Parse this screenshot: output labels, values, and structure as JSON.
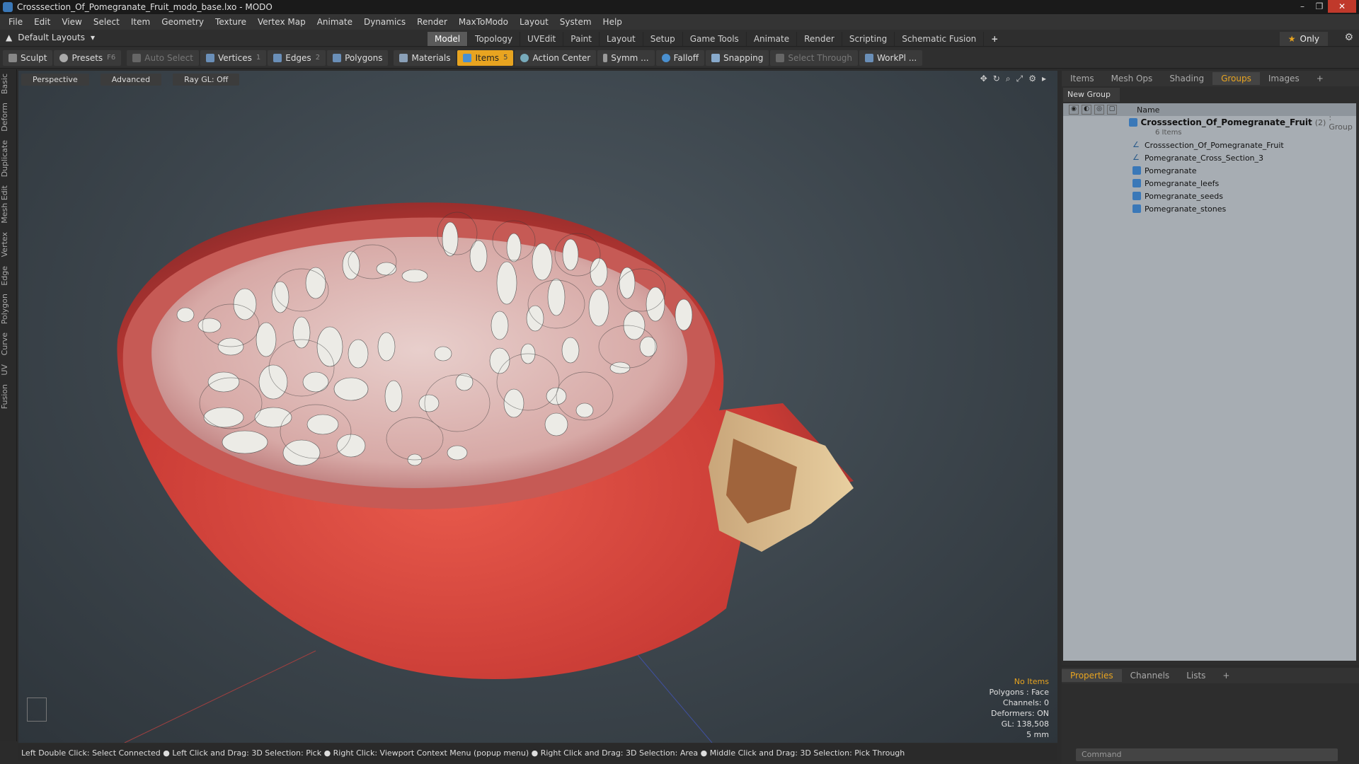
{
  "window": {
    "title": "Crosssection_Of_Pomegranate_Fruit_modo_base.lxo - MODO"
  },
  "menu": [
    "File",
    "Edit",
    "View",
    "Select",
    "Item",
    "Geometry",
    "Texture",
    "Vertex Map",
    "Animate",
    "Dynamics",
    "Render",
    "MaxToModo",
    "Layout",
    "System",
    "Help"
  ],
  "layout": {
    "default_layouts": "Default Layouts",
    "tabs": [
      "Model",
      "Topology",
      "UVEdit",
      "Paint",
      "Layout",
      "Setup",
      "Game Tools",
      "Animate",
      "Render",
      "Scripting",
      "Schematic Fusion"
    ],
    "active_tab": "Model",
    "only_label": "Only"
  },
  "toolbar": {
    "sculpt": "Sculpt",
    "presets": "Presets",
    "presets_key": "F6",
    "auto_select": "Auto Select",
    "vertices": "Vertices",
    "vertices_key": "1",
    "edges": "Edges",
    "edges_key": "2",
    "polygons": "Polygons",
    "materials": "Materials",
    "items": "Items",
    "items_key": "5",
    "action_center": "Action Center",
    "symm": "Symm ...",
    "falloff": "Falloff",
    "snapping": "Snapping",
    "select_through": "Select Through",
    "workpl": "WorkPl ..."
  },
  "left_tabs": [
    "Basic",
    "Deform",
    "Duplicate",
    "Mesh Edit",
    "Vertex",
    "Edge",
    "Polygon",
    "Curve",
    "UV",
    "Fusion"
  ],
  "viewport": {
    "perspective": "Perspective",
    "advanced": "Advanced",
    "raygl": "Ray GL: Off",
    "info": {
      "no_items": "No Items",
      "polygons": "Polygons : Face",
      "channels": "Channels: 0",
      "deformers": "Deformers: ON",
      "gl": "GL: 138,508",
      "scale": "5 mm"
    }
  },
  "status": "Left Double Click: Select Connected ● Left Click and Drag: 3D Selection: Pick ● Right Click: Viewport Context Menu (popup menu) ● Right Click and Drag: 3D Selection: Area ● Middle Click and Drag: 3D Selection: Pick Through",
  "right_panel": {
    "tabs": [
      "Items",
      "Mesh Ops",
      "Shading",
      "Groups",
      "Images"
    ],
    "active_tab": "Groups",
    "new_group": "New Group",
    "name_header": "Name",
    "group": {
      "name": "Crosssection_Of_Pomegranate_Fruit",
      "count": "(2)",
      "type": ": Group",
      "sub": "6 Items"
    },
    "items": [
      {
        "name": "Crosssection_Of_Pomegranate_Fruit",
        "icon": "locator-icon"
      },
      {
        "name": "Pomegranate_Cross_Section_3",
        "icon": "locator-icon"
      },
      {
        "name": "Pomegranate",
        "icon": "mesh-icon"
      },
      {
        "name": "Pomegranate_leefs",
        "icon": "mesh-icon"
      },
      {
        "name": "Pomegranate_seeds",
        "icon": "mesh-icon"
      },
      {
        "name": "Pomegranate_stones",
        "icon": "mesh-icon"
      }
    ]
  },
  "bottom_panel": {
    "tabs": [
      "Properties",
      "Channels",
      "Lists"
    ],
    "active_tab": "Properties",
    "command_placeholder": "Command"
  }
}
